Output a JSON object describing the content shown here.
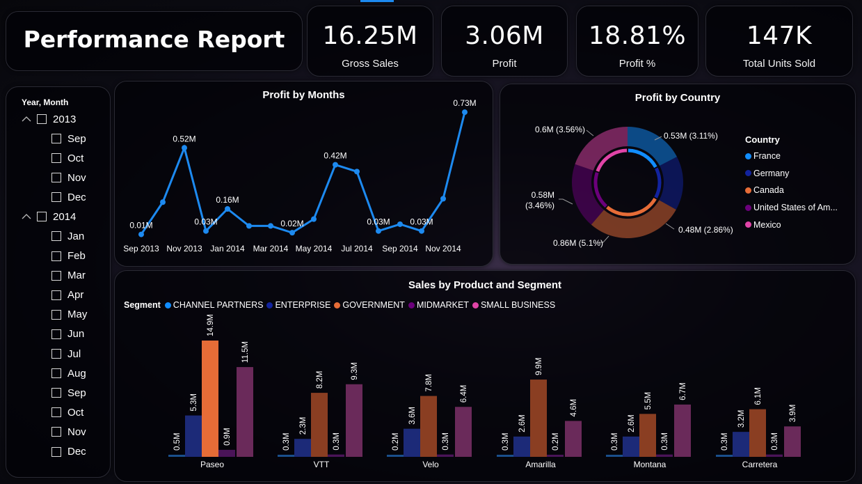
{
  "header": {
    "title": "Performance Report"
  },
  "kpis": [
    {
      "value": "16.25M",
      "label": "Gross Sales"
    },
    {
      "value": "3.06M",
      "label": "Profit"
    },
    {
      "value": "18.81%",
      "label": "Profit %"
    },
    {
      "value": "147K",
      "label": "Total Units Sold"
    }
  ],
  "slicer": {
    "title": "Year, Month",
    "years": [
      {
        "label": "2013",
        "months": [
          "Sep",
          "Oct",
          "Nov",
          "Dec"
        ]
      },
      {
        "label": "2014",
        "months": [
          "Jan",
          "Feb",
          "Mar",
          "Apr",
          "May",
          "Jun",
          "Jul",
          "Aug",
          "Sep",
          "Oct",
          "Nov",
          "Dec"
        ]
      }
    ]
  },
  "colors": {
    "channel_partners": "#118DFF",
    "enterprise": "#12239E",
    "government": "#E66C37",
    "midmarket": "#6B007B",
    "small_business": "#E044A7",
    "line": "#1D8AF0"
  },
  "chart_data": [
    {
      "type": "line",
      "title": "Profit by Months",
      "x": [
        "Sep 2013",
        "Oct 2013",
        "Nov 2013",
        "Dec 2013",
        "Jan 2014",
        "Feb 2014",
        "Mar 2014",
        "Apr 2014",
        "May 2014",
        "Jun 2014",
        "Jul 2014",
        "Aug 2014",
        "Sep 2014",
        "Oct 2014",
        "Nov 2014",
        "Dec 2014"
      ],
      "x_tick_labels": [
        "Sep 2013",
        "Nov 2013",
        "Jan 2014",
        "Mar 2014",
        "May 2014",
        "Jul 2014",
        "Sep 2014",
        "Nov 2014"
      ],
      "values": [
        0.01,
        0.2,
        0.52,
        0.03,
        0.16,
        0.06,
        0.06,
        0.02,
        0.1,
        0.42,
        0.38,
        0.03,
        0.07,
        0.03,
        0.22,
        0.73
      ],
      "data_labels": [
        "0.01M",
        "",
        "0.52M",
        "0.03M",
        "0.16M",
        "",
        "",
        "0.02M",
        "",
        "0.42M",
        "",
        "0.03M",
        "",
        "0.03M",
        "",
        "0.73M"
      ],
      "ylim": [
        0,
        0.8
      ],
      "grid": false
    },
    {
      "type": "pie",
      "title": "Profit by Country",
      "legend_title": "Country",
      "legend_position": "right",
      "categories": [
        "France",
        "Germany",
        "Canada",
        "United States of Am...",
        "Mexico"
      ],
      "values": [
        0.53,
        0.48,
        0.86,
        0.58,
        0.6
      ],
      "data_labels": [
        "0.53M (3.11%)",
        "0.48M (2.86%)",
        "0.86M (5.1%)",
        "0.58M (3.46%)",
        "0.6M (3.56%)"
      ]
    },
    {
      "type": "bar",
      "title": "Sales by Product and Segment",
      "legend_title": "Segment",
      "legend_position": "top-left",
      "categories": [
        "Paseo",
        "VTT",
        "Velo",
        "Amarilla",
        "Montana",
        "Carretera"
      ],
      "series": [
        {
          "name": "CHANNEL PARTNERS",
          "values": [
            0.2,
            0.1,
            0.1,
            0.1,
            0.1,
            0.1
          ]
        },
        {
          "name": "ENTERPRISE",
          "values": [
            5.3,
            2.3,
            3.6,
            2.6,
            2.6,
            3.2
          ]
        },
        {
          "name": "GOVERNMENT",
          "values": [
            14.9,
            8.2,
            7.8,
            9.9,
            5.5,
            6.1
          ]
        },
        {
          "name": "MIDMARKET",
          "values": [
            0.9,
            0.3,
            0.3,
            0.2,
            0.3,
            0.3
          ]
        },
        {
          "name": "SMALL BUSINESS",
          "values": [
            11.5,
            9.3,
            6.4,
            4.6,
            6.7,
            3.9
          ]
        }
      ],
      "data_labels": [
        [
          "0.5M",
          "5.3M",
          "14.9M",
          "0.9M",
          "11.5M"
        ],
        [
          "0.3M",
          "2.3M",
          "8.2M",
          "0.3M",
          "9.3M"
        ],
        [
          "0.2M",
          "3.6M",
          "7.8M",
          "0.3M",
          "6.4M"
        ],
        [
          "0.3M",
          "2.6M",
          "9.9M",
          "0.2M",
          "4.6M"
        ],
        [
          "0.3M",
          "2.6M",
          "5.5M",
          "0.3M",
          "6.7M"
        ],
        [
          "0.3M",
          "3.2M",
          "6.1M",
          "0.3M",
          "3.9M"
        ]
      ],
      "ylim": [
        0,
        15
      ]
    }
  ]
}
